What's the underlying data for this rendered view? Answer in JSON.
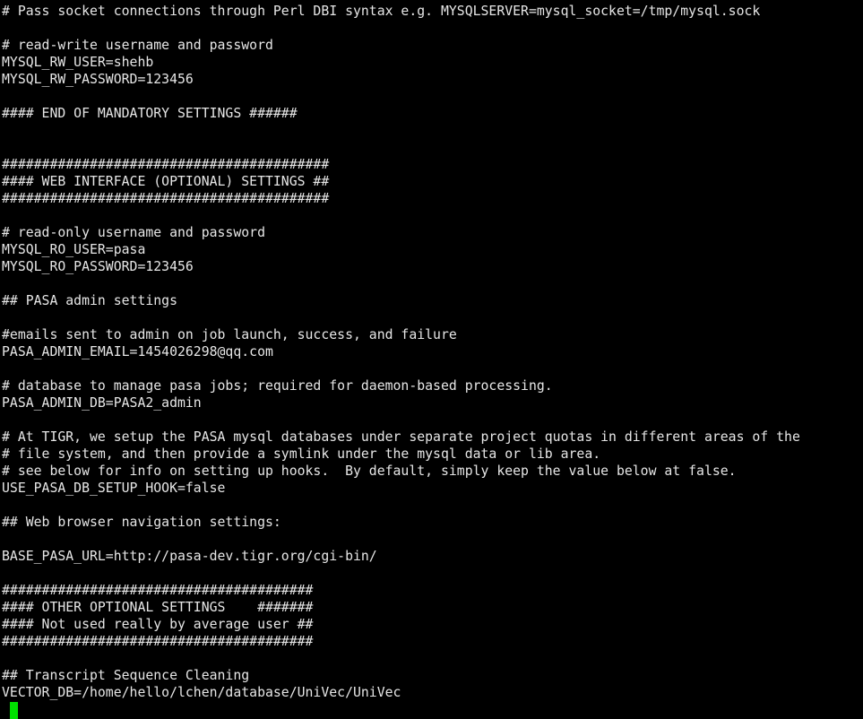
{
  "terminal": {
    "lines": [
      "# Pass socket connections through Perl DBI syntax e.g. MYSQLSERVER=mysql_socket=/tmp/mysql.sock",
      "",
      "# read-write username and password",
      "MYSQL_RW_USER=shehb",
      "MYSQL_RW_PASSWORD=123456",
      "",
      "#### END OF MANDATORY SETTINGS ######",
      "",
      "",
      "#########################################",
      "#### WEB INTERFACE (OPTIONAL) SETTINGS ##",
      "#########################################",
      "",
      "# read-only username and password",
      "MYSQL_RO_USER=pasa",
      "MYSQL_RO_PASSWORD=123456",
      "",
      "## PASA admin settings",
      "",
      "#emails sent to admin on job launch, success, and failure",
      "PASA_ADMIN_EMAIL=1454026298@qq.com",
      "",
      "# database to manage pasa jobs; required for daemon-based processing.",
      "PASA_ADMIN_DB=PASA2_admin",
      "",
      "# At TIGR, we setup the PASA mysql databases under separate project quotas in different areas of the",
      "# file system, and then provide a symlink under the mysql data or lib area.",
      "# see below for info on setting up hooks.  By default, simply keep the value below at false.",
      "USE_PASA_DB_SETUP_HOOK=false",
      "",
      "## Web browser navigation settings:",
      "",
      "BASE_PASA_URL=http://pasa-dev.tigr.org/cgi-bin/",
      "",
      "#######################################",
      "#### OTHER OPTIONAL SETTINGS    #######",
      "#### Not used really by average user ##",
      "#######################################",
      "",
      "## Transcript Sequence Cleaning",
      "VECTOR_DB=/home/hello/lchen/database/UniVec/UniVec"
    ],
    "cursor_color": "#00e000"
  }
}
